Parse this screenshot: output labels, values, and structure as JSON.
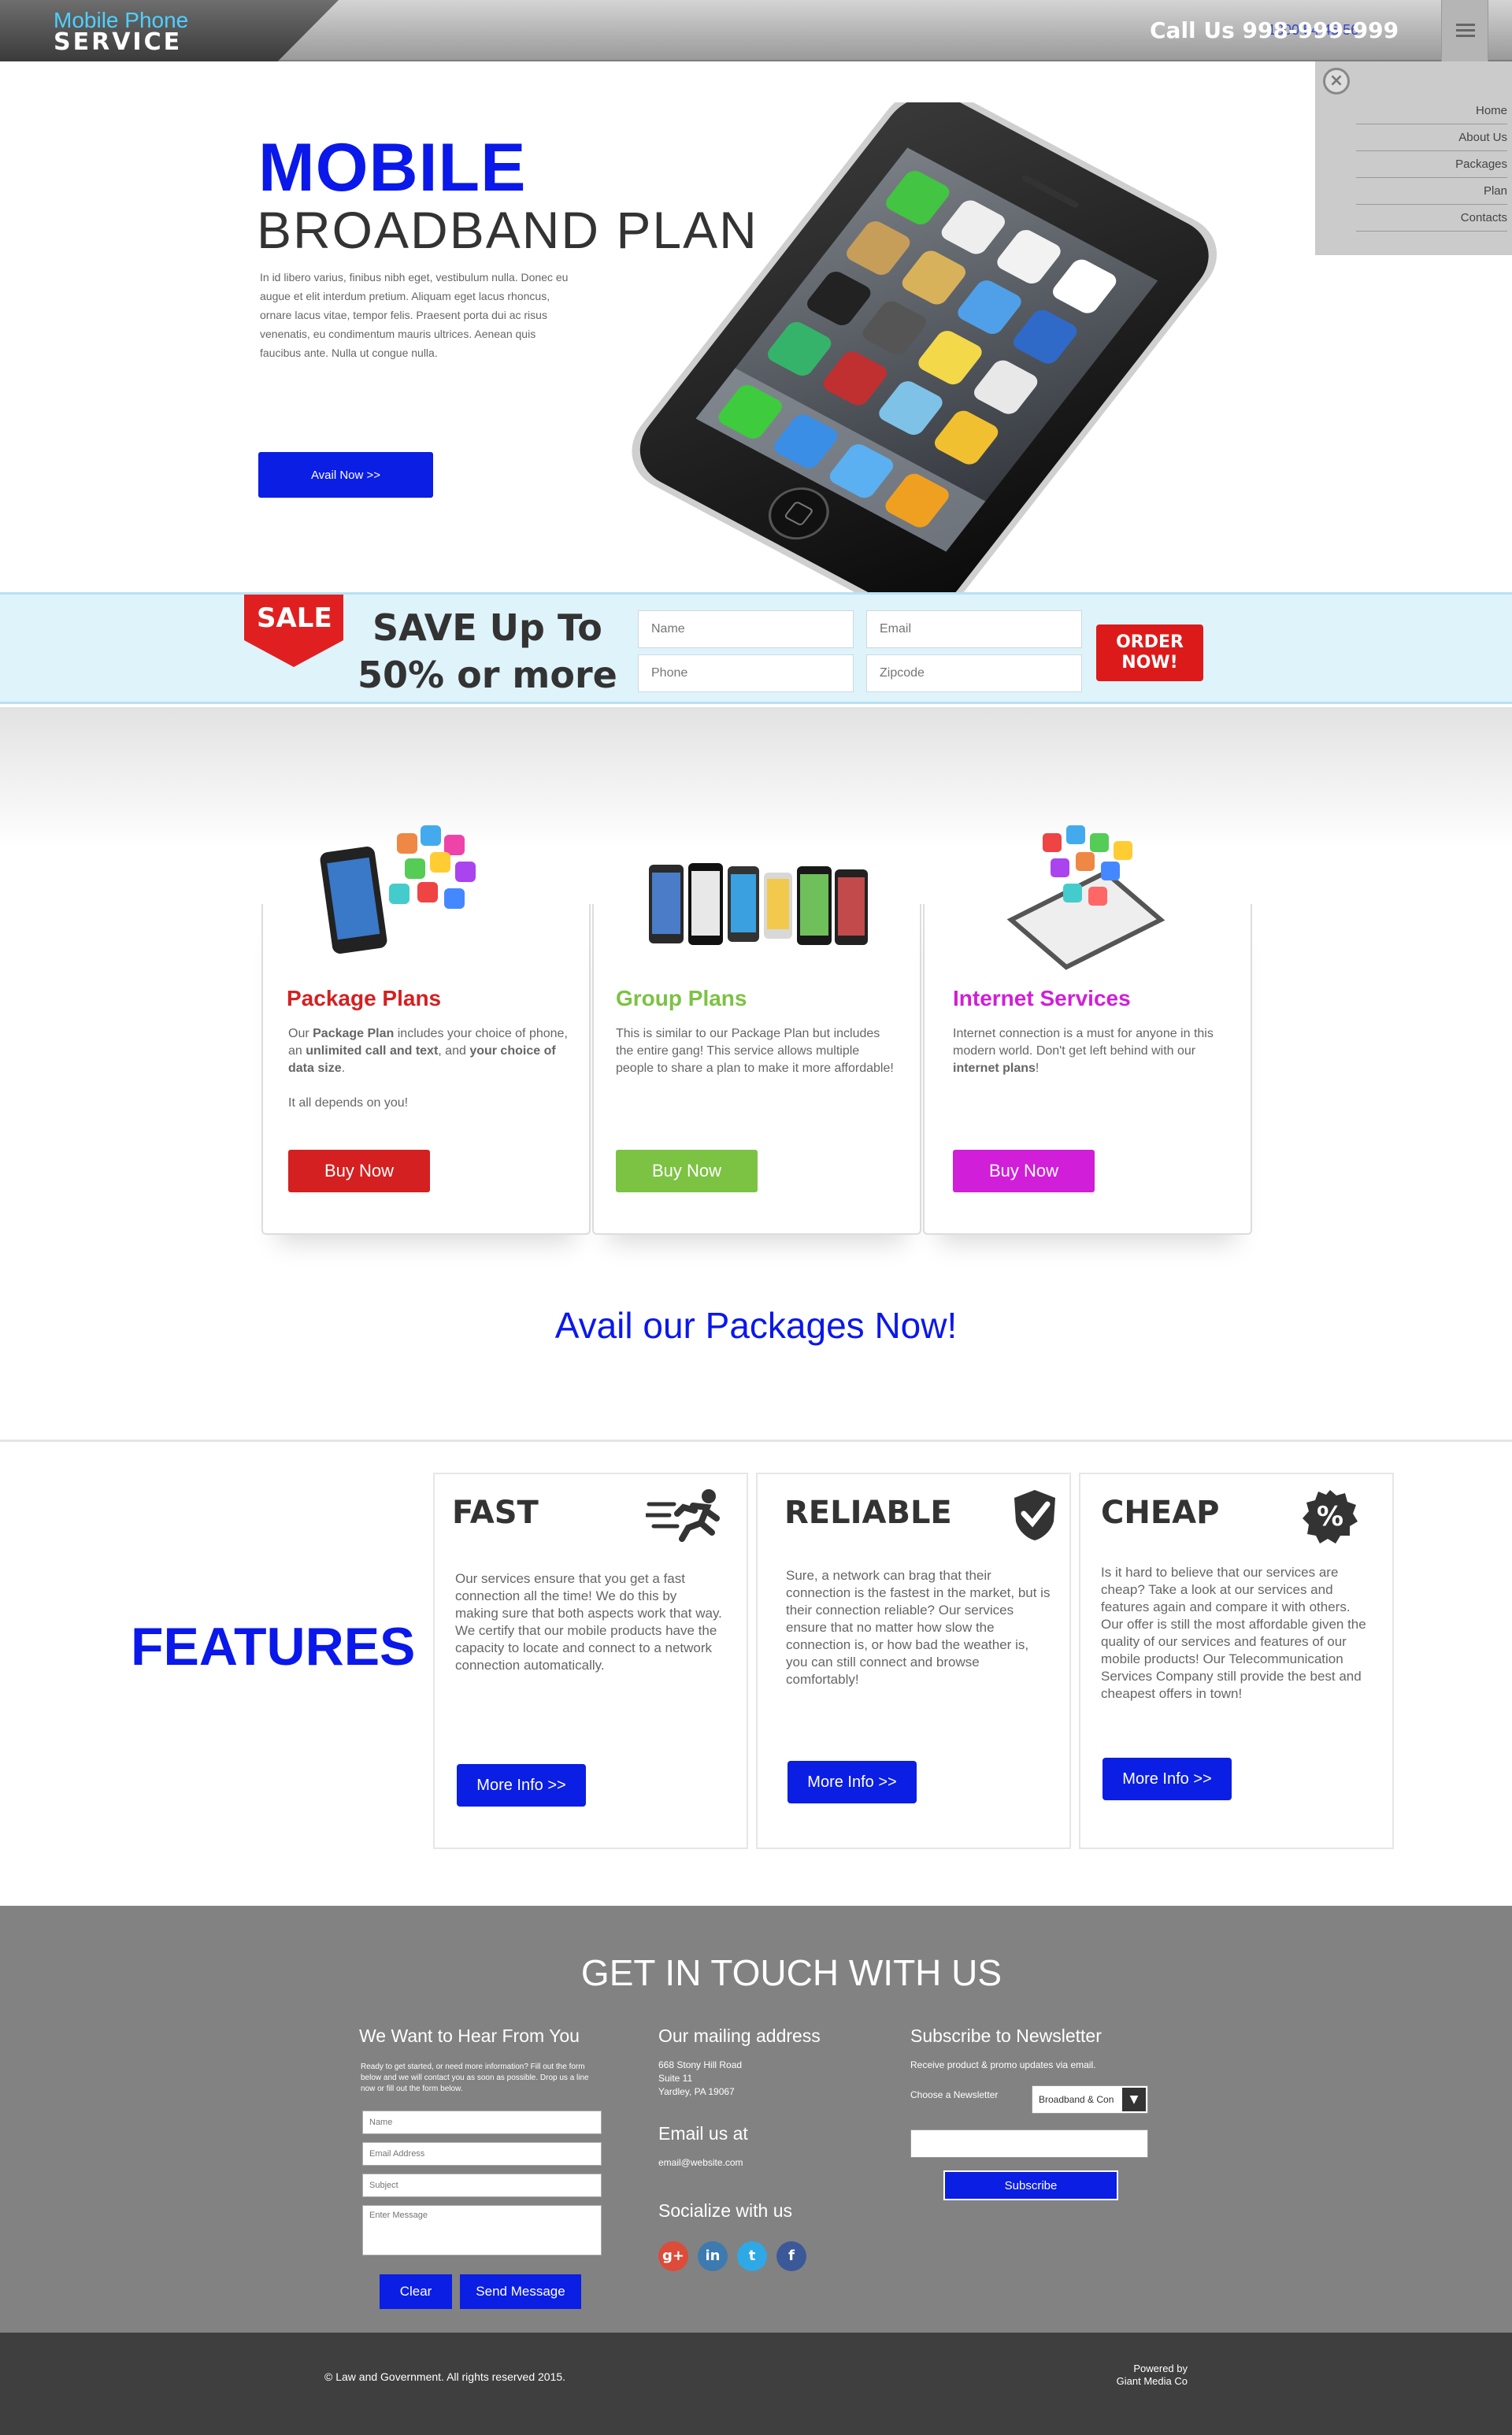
{
  "header": {
    "logo_line1": "Mobile Phone",
    "logo_line2": "SERVICE",
    "call_us": "Call Us 998-999-999",
    "call_alt": "1800 54 45 56"
  },
  "menu": {
    "close_icon": "close-icon",
    "items": [
      "Home",
      "About Us",
      "Packages",
      "Plan",
      "Contacts"
    ]
  },
  "hero": {
    "title_line1": "MOBILE",
    "title_line2": "BROADBAND PLAN",
    "body": "In id libero varius, finibus nibh eget, vestibulum nulla. Donec eu augue et elit interdum pretium. Aliquam eget lacus rhoncus, ornare lacus vitae, tempor felis. Praesent porta dui ac risus venenatis, eu condimentum mauris ultrices. Aenean quis faucibus ante. Nulla ut congue nulla.",
    "button": "Avail Now >>"
  },
  "sale": {
    "tag": "SALE",
    "headline_line1": "SAVE Up To",
    "headline_line2": "50% or more",
    "fields": {
      "name": "Name",
      "email": "Email",
      "phone": "Phone",
      "zipcode": "Zipcode"
    },
    "button_line1": "ORDER",
    "button_line2": "NOW!"
  },
  "packages": [
    {
      "title": "Package Plans",
      "color": "#d42020",
      "text_parts": [
        "Our ",
        "Package Plan",
        " includes your choice of phone, an ",
        "unlimited call and text",
        ", and ",
        "your choice of data size",
        "."
      ],
      "text2": "It all depends on you!",
      "button": "Buy Now"
    },
    {
      "title": "Group Plans",
      "color": "#7cc243",
      "text": "This is similar to our Package Plan but includes the entire gang! This service allows multiple people to share a plan to make it more affordable!",
      "button": "Buy Now"
    },
    {
      "title": "Internet Services",
      "color": "#d11ed8",
      "text_parts": [
        "Internet connection is a must for anyone in this modern world. Don't get left behind with our ",
        "internet plans",
        "!"
      ],
      "button": "Buy Now"
    }
  ],
  "avail_packages": "Avail our Packages Now!",
  "features": {
    "heading": "FEATURES",
    "cards": [
      {
        "title": "FAST",
        "icon": "running-man-icon",
        "text": "Our services ensure that you get a fast connection all the time! We do this by making sure that both aspects work that way. We certify that our mobile products have the capacity to locate and connect to a network connection automatically.",
        "button": "More Info >>"
      },
      {
        "title": "RELIABLE",
        "icon": "shield-check-icon",
        "text": "Sure, a network can brag that their connection is the fastest in the market, but is their connection reliable? Our services ensure that no matter how slow the connection is, or how bad the weather is, you can still connect and browse comfortably!",
        "button": "More Info >>"
      },
      {
        "title": "CHEAP",
        "icon": "percent-badge-icon",
        "text": "Is it hard to believe that our services are cheap? Take a look at our services and features again and compare it with others. Our offer is still the most affordable given the quality of our services and features of our mobile products! Our Telecommunication Services Company still provide the best and cheapest offers in town!",
        "button": "More Info >>"
      }
    ]
  },
  "contact": {
    "title": "GET IN TOUCH WITH US",
    "form": {
      "heading": "We Want to Hear From You",
      "intro": "Ready to get started, or need more information? Fill out the form below and we will contact you as soon as possible. Drop us a line now or fill out the form below.",
      "name": "Name",
      "email": "Email Address",
      "subject": "Subject",
      "message": "Enter Message",
      "clear": "Clear",
      "send": "Send Message"
    },
    "mailing": {
      "heading": "Our mailing address",
      "line1": "668 Stony Hill Road",
      "line2": "Suite 11",
      "line3": "Yardley, PA 19067"
    },
    "email": {
      "heading": "Email us at",
      "address": "email@website.com"
    },
    "social": {
      "heading": "Socialize with us",
      "icons": [
        "google-plus-icon",
        "linkedin-icon",
        "twitter-icon",
        "facebook-icon"
      ],
      "glyphs": [
        "g+",
        "in",
        "t",
        "f"
      ]
    },
    "newsletter": {
      "heading": "Subscribe to Newsletter",
      "intro": "Receive product & promo updates via email.",
      "choose_label": "Choose a Newsletter",
      "selected": "Broadband & Con",
      "button": "Subscribe"
    }
  },
  "footer": {
    "copyright": "© Law and Government. All rights reserved 2015.",
    "powered_by": "Powered by",
    "company": "Giant Media Co"
  }
}
